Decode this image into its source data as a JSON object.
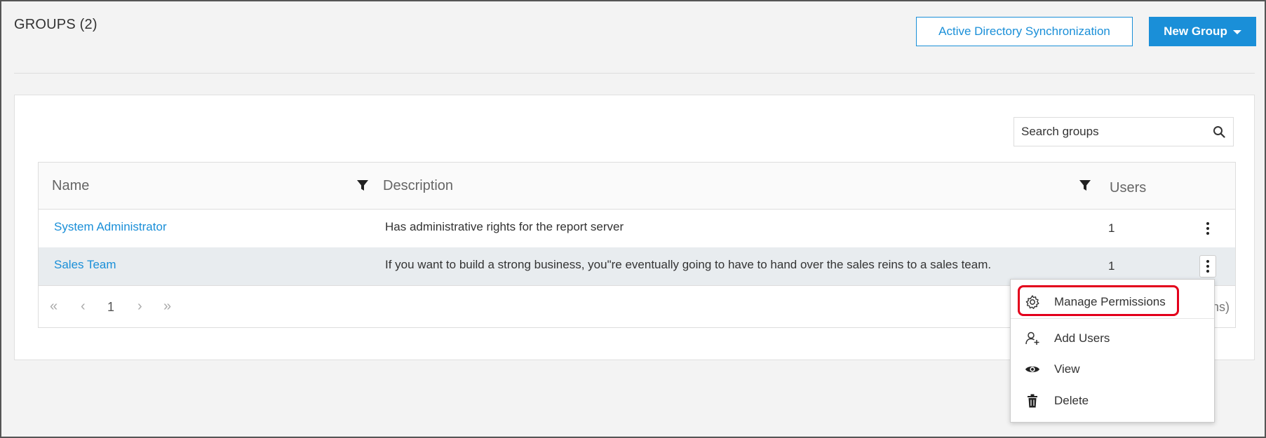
{
  "page": {
    "title": "GROUPS (2)"
  },
  "header": {
    "ad_sync_label": "Active Directory Synchronization",
    "new_group_label": "New Group"
  },
  "search": {
    "placeholder": "Search groups"
  },
  "table": {
    "columns": {
      "name": "Name",
      "description": "Description",
      "users": "Users"
    },
    "rows": [
      {
        "name": "System Administrator",
        "description": "Has administrative rights for the report server",
        "users": "1"
      },
      {
        "name": "Sales Team",
        "description": "If you want to build a strong business, you\"re eventually going to have to hand over the sales reins to a sales team.",
        "users": "1"
      }
    ]
  },
  "pager": {
    "page": "1",
    "info_visible": "ns)"
  },
  "context_menu": {
    "items": [
      {
        "label": "Manage Permissions",
        "icon": "gear-icon"
      },
      {
        "label": "Add Users",
        "icon": "add-user-icon"
      },
      {
        "label": "View",
        "icon": "eye-icon"
      },
      {
        "label": "Delete",
        "icon": "trash-icon"
      }
    ]
  },
  "colors": {
    "accent": "#1a8fd8",
    "highlight": "#e3001b",
    "selected_row": "#e8ecef"
  }
}
